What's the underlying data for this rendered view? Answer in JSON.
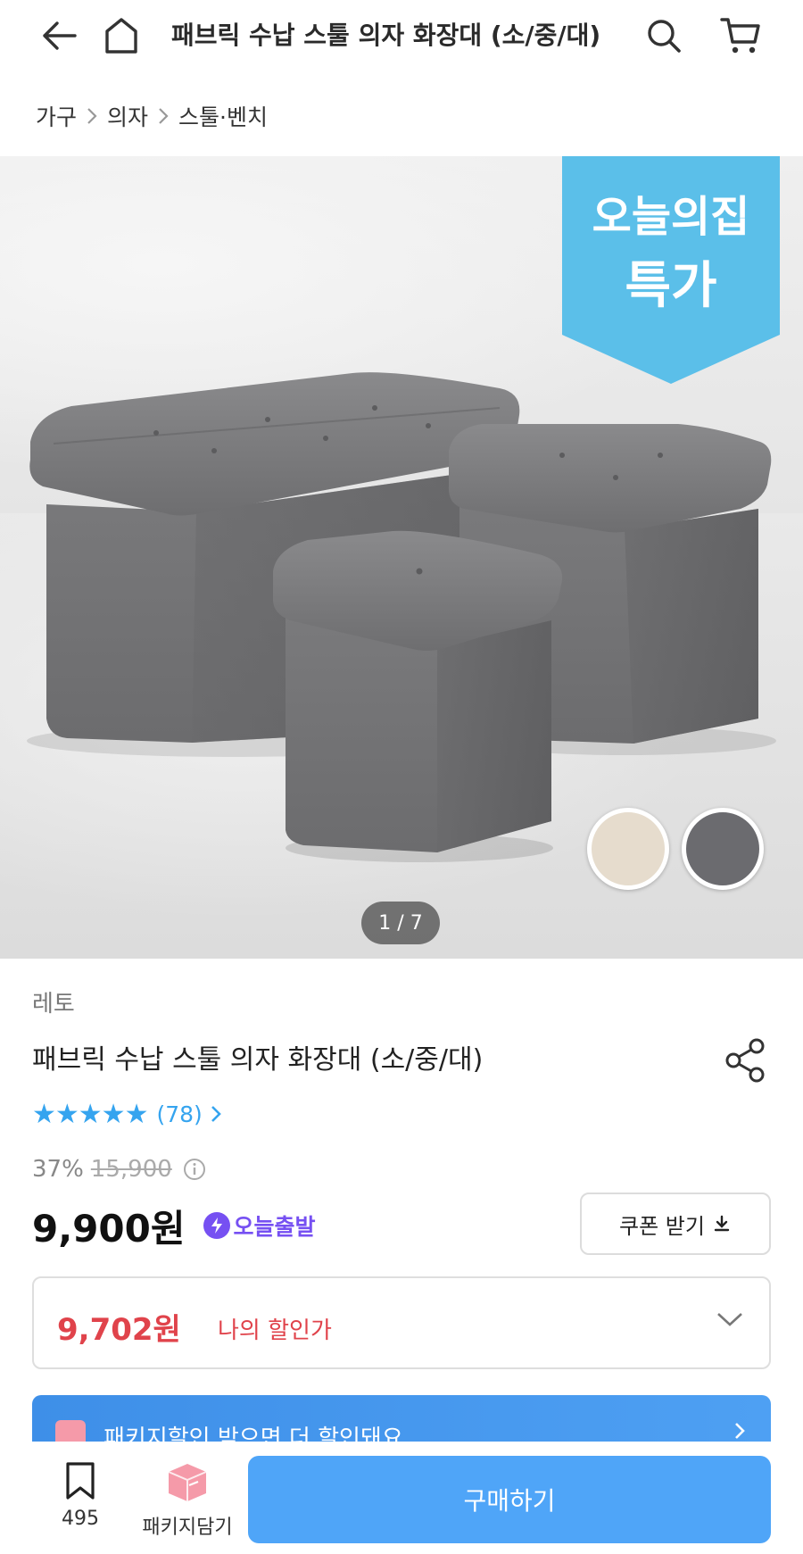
{
  "header": {
    "title": "패브릭 수납 스툴 의자 화장대 (소/중/대)",
    "back_icon": "arrow-left-icon",
    "home_icon": "home-icon",
    "search_icon": "search-icon",
    "cart_icon": "cart-icon"
  },
  "breadcrumb": [
    "가구",
    "의자",
    "스툴·벤치"
  ],
  "hero": {
    "promo_line1": "오늘의집",
    "promo_line2": "특가",
    "promo_color": "#5bbfe9",
    "counter": "1 / 7",
    "swatches": [
      "#e6dccd",
      "#6b6b6f"
    ]
  },
  "product": {
    "brand": "레토",
    "name": "패브릭 수납 스툴 의자 화장대 (소/중/대)",
    "rating_stars": "★★★★★",
    "review_count": "(78)",
    "discount_rate": "37%",
    "original_price": "15,900",
    "price": "9,900원",
    "today_badge": "오늘출발",
    "coupon_button": "쿠폰 받기",
    "my_price": "9,702원",
    "my_price_label": "나의 할인가",
    "package_banner": "패키지할인 받으면 더 할인돼요"
  },
  "bottom_bar": {
    "bookmark_count": "495",
    "package_label": "패키지담기",
    "buy_button": "구매하기"
  },
  "colors": {
    "accent_blue": "#4fa5f8",
    "star_blue": "#35a4ef",
    "sale_red": "#e0434b",
    "badge_purple": "#7650f2"
  }
}
